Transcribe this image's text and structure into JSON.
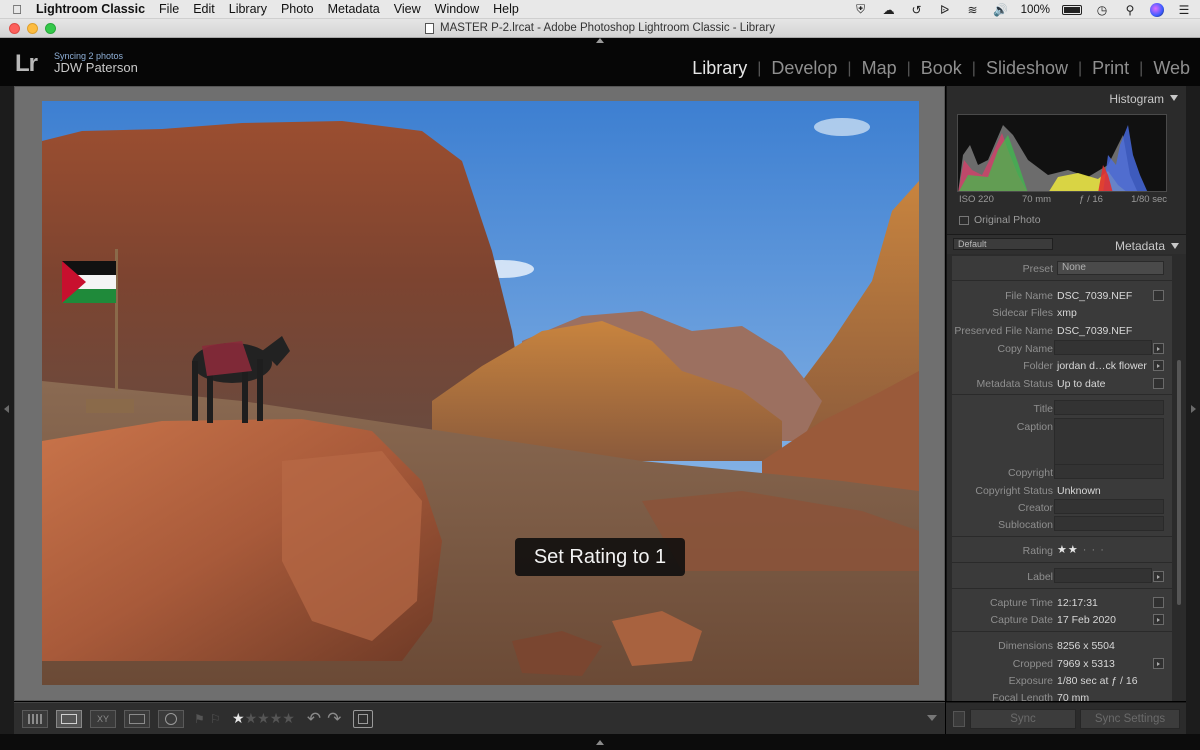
{
  "menubar": {
    "app_name": "Lightroom Classic",
    "items": [
      "File",
      "Edit",
      "Library",
      "Photo",
      "Metadata",
      "View",
      "Window",
      "Help"
    ],
    "battery": "100%"
  },
  "window": {
    "title": "MASTER P-2.lrcat - Adobe Photoshop Lightroom Classic - Library"
  },
  "header": {
    "logo": "Lr",
    "sync_status": "Syncing 2 photos",
    "user": "JDW Paterson",
    "modules": [
      "Library",
      "Develop",
      "Map",
      "Book",
      "Slideshow",
      "Print",
      "Web"
    ],
    "active_module": "Library"
  },
  "viewer": {
    "hud_message": "Set Rating to 1"
  },
  "histogram": {
    "title": "Histogram",
    "iso": "ISO 220",
    "focal": "70 mm",
    "aperture": "ƒ / 16",
    "shutter": "1/80 sec",
    "original_photo_label": "Original Photo"
  },
  "metadata": {
    "title": "Metadata",
    "preset_dropdown": "Default",
    "preset_label": "Preset",
    "preset_value": "None",
    "file_name_label": "File Name",
    "file_name": "DSC_7039.NEF",
    "sidecar_label": "Sidecar Files",
    "sidecar": "xmp",
    "preserved_label": "Preserved File Name",
    "preserved": "DSC_7039.NEF",
    "copy_name_label": "Copy Name",
    "folder_label": "Folder",
    "folder": "jordan d…ck flower",
    "md_status_label": "Metadata Status",
    "md_status": "Up to date",
    "title_label": "Title",
    "caption_label": "Caption",
    "copyright_label": "Copyright",
    "copyright_status_label": "Copyright Status",
    "copyright_status": "Unknown",
    "creator_label": "Creator",
    "sublocation_label": "Sublocation",
    "rating_label": "Rating",
    "rating_stars": "★★",
    "rating_dots": "· · ·",
    "label_label": "Label",
    "capture_time_label": "Capture Time",
    "capture_time": "12:17:31",
    "capture_date_label": "Capture Date",
    "capture_date": "17 Feb 2020",
    "dimensions_label": "Dimensions",
    "dimensions": "8256 x 5504",
    "cropped_label": "Cropped",
    "cropped": "7969 x 5313",
    "exposure_label": "Exposure",
    "exposure": "1/80 sec at ƒ / 16",
    "focal_label": "Focal Length",
    "focal": "70 mm"
  },
  "sync": {
    "sync_label": "Sync",
    "sync_settings_label": "Sync Settings"
  },
  "toolbar": {
    "rating": 1
  }
}
